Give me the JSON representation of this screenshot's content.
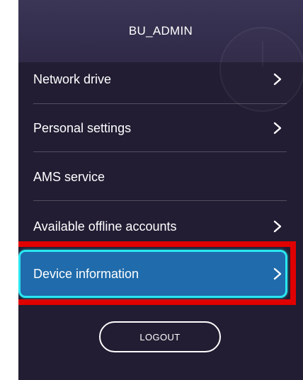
{
  "header": {
    "title": "BU_ADMIN"
  },
  "menu": {
    "items": [
      {
        "label": "Network drive",
        "icon": "chevron-right-icon",
        "has_chevron": true
      },
      {
        "label": "Personal settings",
        "icon": "chevron-right-icon",
        "has_chevron": true
      },
      {
        "label": "AMS service",
        "has_chevron": false
      },
      {
        "label": "Available offline accounts",
        "icon": "chevron-right-icon",
        "has_chevron": true
      },
      {
        "label": "Device information",
        "icon": "chevron-right-icon",
        "has_chevron": true,
        "selected": true
      }
    ]
  },
  "logout": {
    "label": "LOGOUT"
  },
  "colors": {
    "panel_background": "#221d33",
    "header_background": "#3b3556",
    "selected_background": "#1f6bab",
    "selected_border": "#2ae6f2",
    "highlight_outline": "#e00000",
    "text": "#ffffff"
  }
}
